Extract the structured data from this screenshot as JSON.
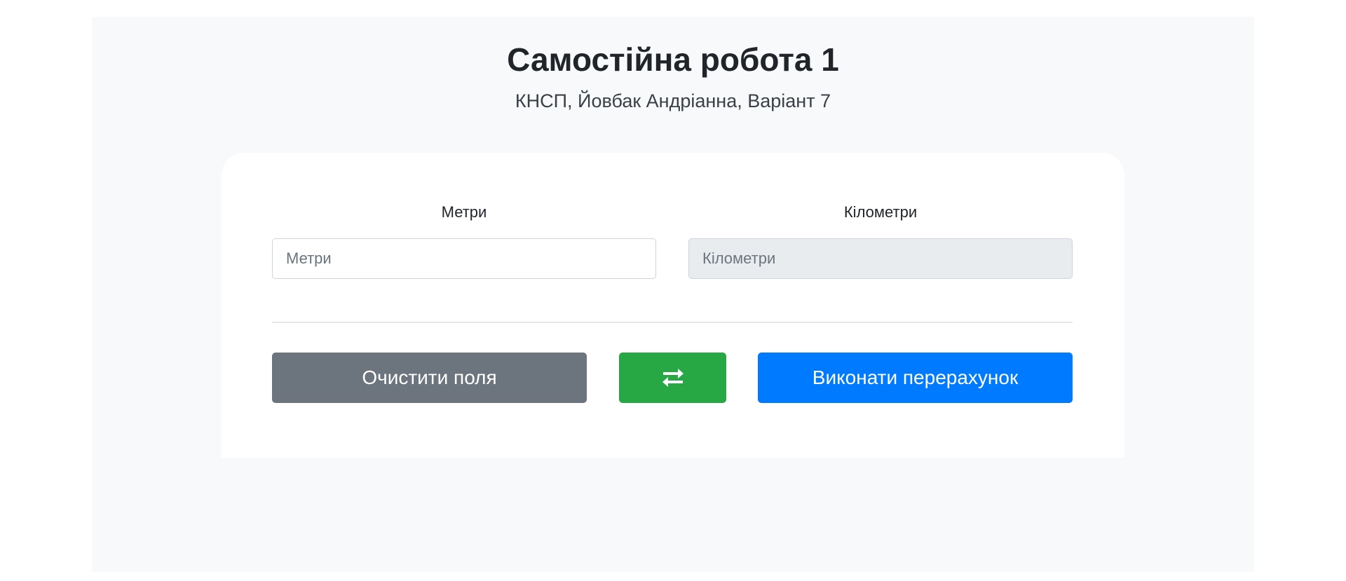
{
  "header": {
    "title": "Самостійна робота 1",
    "subtitle": "КНСП, Йовбак Андріанна, Варіант 7"
  },
  "form": {
    "meters": {
      "label": "Метри",
      "placeholder": "Метри",
      "value": ""
    },
    "kilometers": {
      "label": "Кілометри",
      "placeholder": "Кілометри",
      "value": "",
      "readonly": true
    }
  },
  "buttons": {
    "clear_label": "Очистити поля",
    "swap_icon": "swap-arrows-icon",
    "calculate_label": "Виконати перерахунок"
  },
  "colors": {
    "page_background": "#f8f9fa",
    "clear_button": "#6c757d",
    "swap_button": "#28a745",
    "calculate_button": "#007bff"
  }
}
